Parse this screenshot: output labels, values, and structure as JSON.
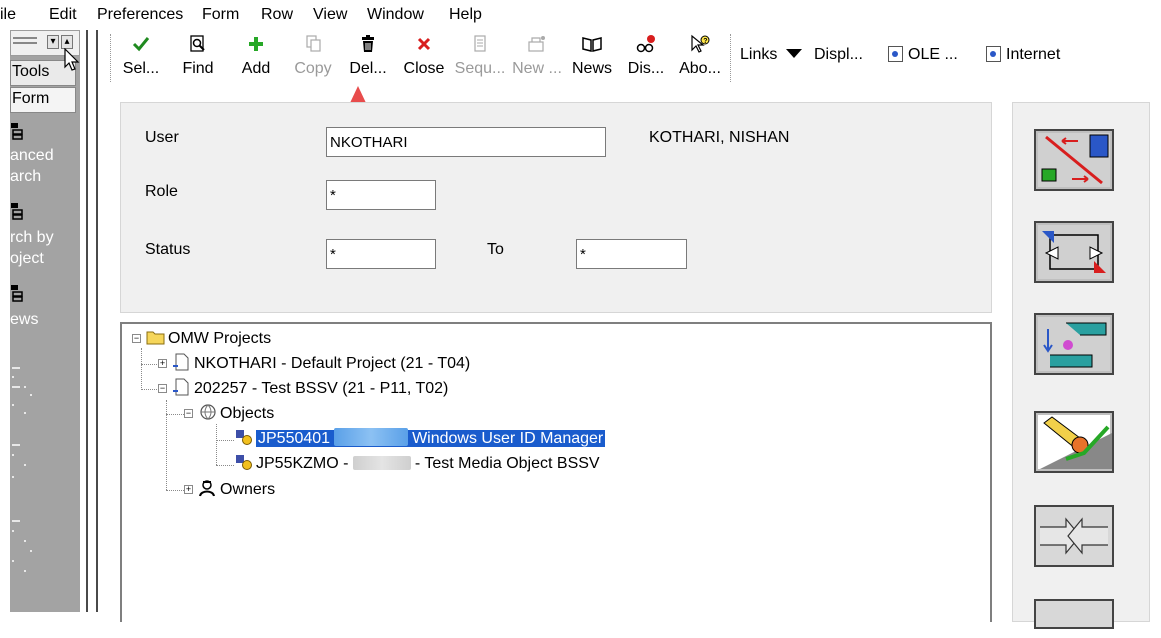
{
  "menu": [
    "ile",
    "Edit",
    "Preferences",
    "Form",
    "Row",
    "View",
    "Window",
    "Help"
  ],
  "sidebar": {
    "tabs": [
      "Tools",
      "Form"
    ],
    "items": [
      {
        "label_lines": [
          "anced",
          "arch"
        ],
        "icon": "tree-diagram-icon"
      },
      {
        "label_lines": [
          "rch by",
          "oject"
        ],
        "icon": "tree-diagram-icon"
      },
      {
        "label_lines": [
          "ews"
        ],
        "icon": "tree-diagram-icon"
      }
    ]
  },
  "toolbar": {
    "buttons": [
      {
        "label": "Sel...",
        "icon": "checkmark-icon",
        "enabled": true
      },
      {
        "label": "Find",
        "icon": "find-icon",
        "enabled": true
      },
      {
        "label": "Add",
        "icon": "plus-icon",
        "enabled": true
      },
      {
        "label": "Copy",
        "icon": "copy-icon",
        "enabled": false
      },
      {
        "label": "Del...",
        "icon": "trash-icon",
        "enabled": true
      },
      {
        "label": "Close",
        "icon": "close-x-icon",
        "enabled": true
      },
      {
        "label": "Sequ...",
        "icon": "sequence-icon",
        "enabled": false
      },
      {
        "label": "New ...",
        "icon": "new-icon",
        "enabled": false
      },
      {
        "label": "News",
        "icon": "book-icon",
        "enabled": true
      },
      {
        "label": "Dis...",
        "icon": "display-icon",
        "enabled": true
      },
      {
        "label": "Abo...",
        "icon": "about-icon",
        "enabled": true
      }
    ],
    "links": [
      "Links",
      "Displ...",
      "OLE ...",
      "Internet"
    ]
  },
  "form": {
    "user_label": "User",
    "user_value": "NKOTHARI",
    "user_name": "KOTHARI, NISHAN",
    "role_label": "Role",
    "role_value": "*",
    "status_label": "Status",
    "status_value": "*",
    "to_label": "To",
    "to_value": "*"
  },
  "tree": {
    "root": "OMW Projects",
    "project1": "NKOTHARI - Default Project (21 - T04)",
    "project2": "202257 - Test BSSV (21 - P11, T02)",
    "objects": "Objects",
    "object1_prefix": "JP550401",
    "object1_suffix": "Windows User ID Manager",
    "object2_prefix": "JP55KZMO - ",
    "object2_suffix": "- Test Media Object BSSV",
    "owners": "Owners"
  },
  "colors": {
    "selection": "#1a5ccd",
    "sidebar_bg": "#a3a3a3",
    "panel_bg": "#f0f0f0",
    "arrow": "#e84c4c"
  }
}
